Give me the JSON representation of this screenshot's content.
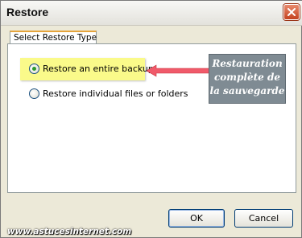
{
  "window": {
    "title": "Restore"
  },
  "icons": {
    "close": "close-icon",
    "arrow": "arrow-icon"
  },
  "tab": {
    "label": "Select Restore Type"
  },
  "options": [
    {
      "label": "Restore an entire backup",
      "checked": true
    },
    {
      "label": "Restore individual files or folders",
      "checked": false
    }
  ],
  "annotation": {
    "lines": [
      "Restauration",
      "complète de",
      "la sauvegarde"
    ]
  },
  "buttons": {
    "ok": "OK",
    "cancel": "Cancel"
  },
  "watermark": "www.astucesinternet.com",
  "colors": {
    "annotation_arrow": "#f05a6a",
    "highlight": "#fafa8a",
    "annotation_box": "#7f8b93"
  }
}
